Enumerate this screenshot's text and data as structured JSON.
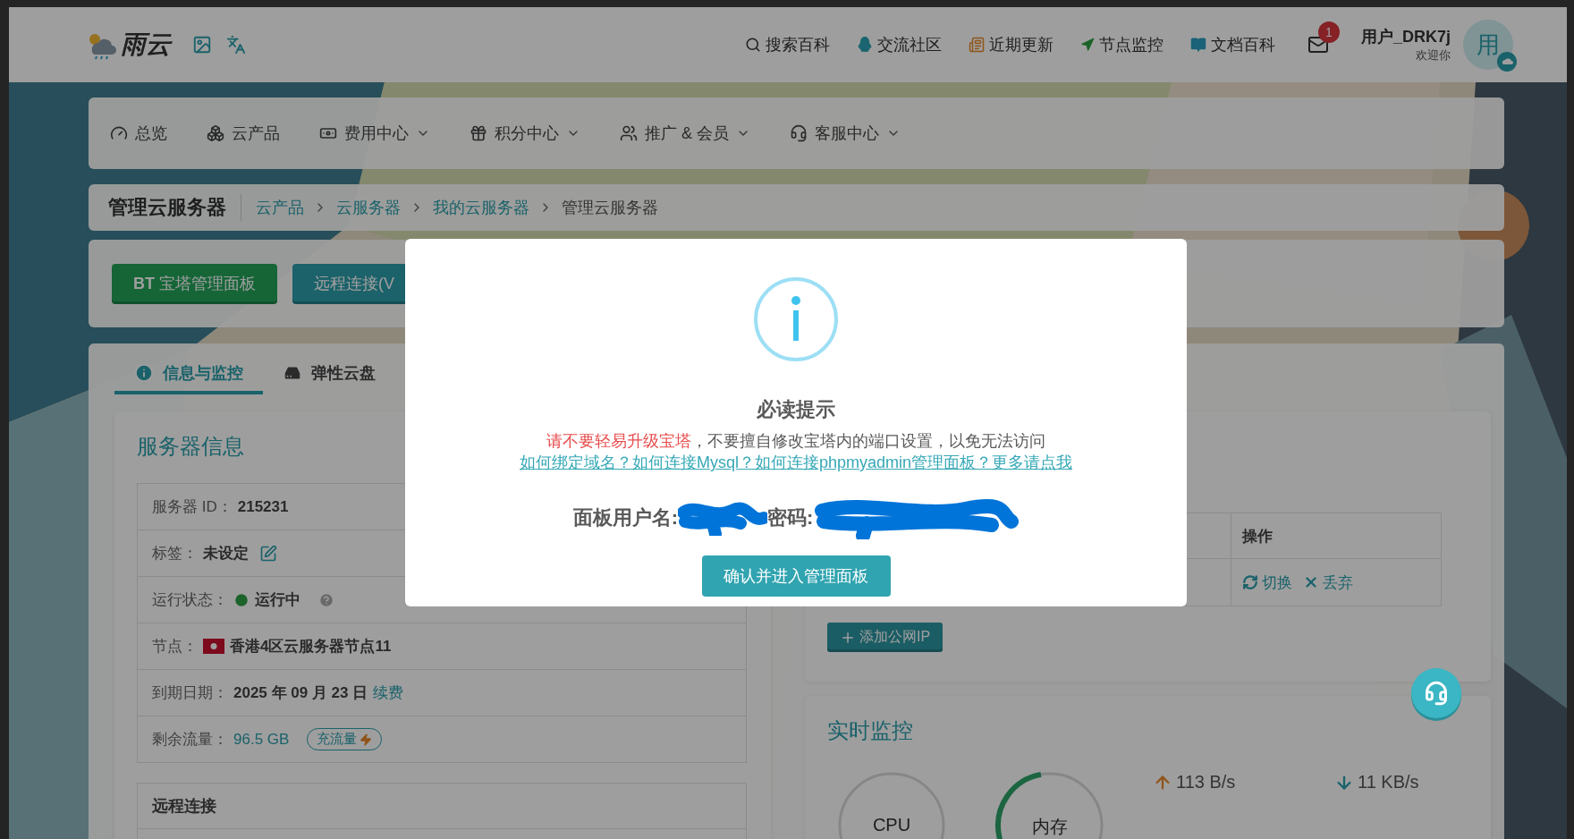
{
  "header": {
    "logo": "雨云",
    "nav": [
      {
        "label": "搜索百科"
      },
      {
        "label": "交流社区"
      },
      {
        "label": "近期更新"
      },
      {
        "label": "节点监控"
      },
      {
        "label": "文档百科"
      }
    ],
    "mail_badge": "1",
    "user": {
      "name": "用户_DRK7j",
      "greeting": "欢迎你",
      "avatar": "用"
    }
  },
  "menu": [
    {
      "label": "总览",
      "dropdown": false
    },
    {
      "label": "云产品",
      "dropdown": false
    },
    {
      "label": "费用中心",
      "dropdown": true
    },
    {
      "label": "积分中心",
      "dropdown": true
    },
    {
      "label": "推广 & 会员",
      "dropdown": true
    },
    {
      "label": "客服中心",
      "dropdown": true
    }
  ],
  "breadcrumb": {
    "title": "管理云服务器",
    "path": [
      {
        "label": "云产品",
        "link": true
      },
      {
        "label": "云服务器",
        "link": true
      },
      {
        "label": "我的云服务器",
        "link": true
      },
      {
        "label": "管理云服务器",
        "link": false
      }
    ]
  },
  "actions": [
    {
      "label": "**BT** 宝塔管理面板",
      "kind": "success"
    },
    {
      "label": "远程连接(V",
      "kind": "info"
    }
  ],
  "tabs": [
    {
      "label": "信息与监控",
      "selected": true
    },
    {
      "label": "弹性云盘",
      "selected": false
    }
  ],
  "server_info": {
    "title": "服务器信息",
    "rows": [
      {
        "kind": "text",
        "label": "服务器 ID：",
        "value": "215231"
      },
      {
        "kind": "tag",
        "label": "标签：",
        "value": "未设定"
      },
      {
        "kind": "status",
        "label": "运行状态：",
        "value": "运行中"
      },
      {
        "kind": "node",
        "label": "节点：",
        "value": "香港4区云服务器节点11"
      },
      {
        "kind": "expiry",
        "label": "到期日期：",
        "value": "2025 年 09 月 23 日",
        "action": "续费"
      },
      {
        "kind": "traffic",
        "label": "剩余流量：",
        "value": "96.5 GB",
        "action": "充流量"
      }
    ],
    "remote_title": "远程连接"
  },
  "ip_table": {
    "columns": [
      "操作"
    ],
    "rows": [
      {
        "actions": [
          "切换",
          "丢弃"
        ]
      }
    ],
    "add_button": "添加公网IP"
  },
  "monitor": {
    "title": "实时监控",
    "gauges": [
      {
        "label": "CPU"
      },
      {
        "label": "内存"
      }
    ],
    "upload": "113 B/s",
    "download": "11 KB/s"
  },
  "modal": {
    "title": "必读提示",
    "warning": [
      {
        "text": "请不要轻易升级宝塔",
        "emphasis": true
      },
      {
        "text": "，不要擅自修改宝塔内的端口设置，以免无法访问",
        "emphasis": false
      }
    ],
    "link": "如何绑定域名？如何连接Mysql？如何连接phpmyadmin管理面板？更多请点我",
    "credentials": [
      {
        "label": "面板用户名:",
        "redacted": true
      },
      {
        "label": "密码:",
        "redacted": true
      }
    ],
    "confirm": "确认并进入管理面板"
  }
}
